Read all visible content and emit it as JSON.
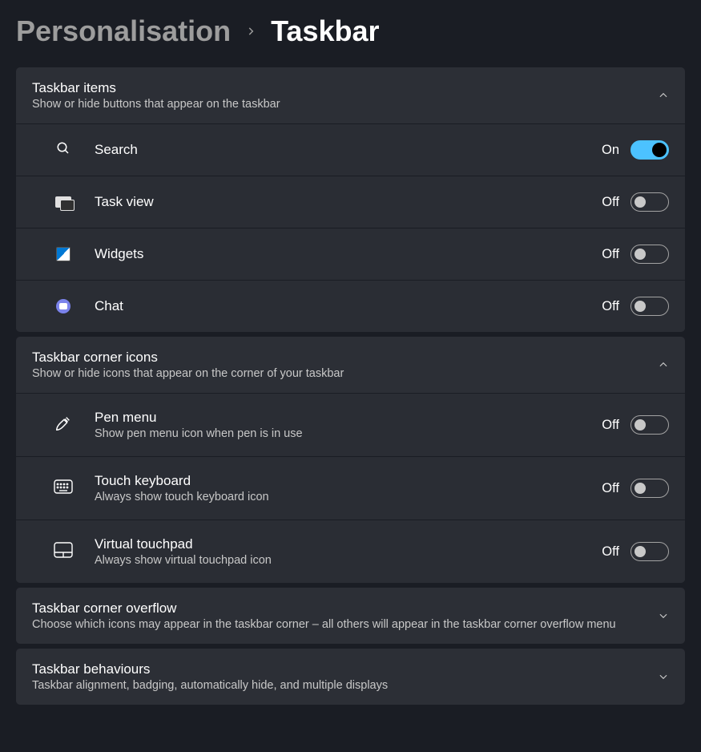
{
  "breadcrumb": {
    "parent": "Personalisation",
    "current": "Taskbar"
  },
  "state": {
    "on": "On",
    "off": "Off"
  },
  "sections": {
    "items": {
      "title": "Taskbar items",
      "subtitle": "Show or hide buttons that appear on the taskbar",
      "rows": [
        {
          "label": "Search",
          "state": "On",
          "on": true
        },
        {
          "label": "Task view",
          "state": "Off",
          "on": false
        },
        {
          "label": "Widgets",
          "state": "Off",
          "on": false
        },
        {
          "label": "Chat",
          "state": "Off",
          "on": false
        }
      ]
    },
    "corner": {
      "title": "Taskbar corner icons",
      "subtitle": "Show or hide icons that appear on the corner of your taskbar",
      "rows": [
        {
          "label": "Pen menu",
          "desc": "Show pen menu icon when pen is in use",
          "state": "Off",
          "on": false
        },
        {
          "label": "Touch keyboard",
          "desc": "Always show touch keyboard icon",
          "state": "Off",
          "on": false
        },
        {
          "label": "Virtual touchpad",
          "desc": "Always show virtual touchpad icon",
          "state": "Off",
          "on": false
        }
      ]
    },
    "overflow": {
      "title": "Taskbar corner overflow",
      "subtitle": "Choose which icons may appear in the taskbar corner – all others will appear in the taskbar corner overflow menu"
    },
    "behaviours": {
      "title": "Taskbar behaviours",
      "subtitle": "Taskbar alignment, badging, automatically hide, and multiple displays"
    }
  }
}
